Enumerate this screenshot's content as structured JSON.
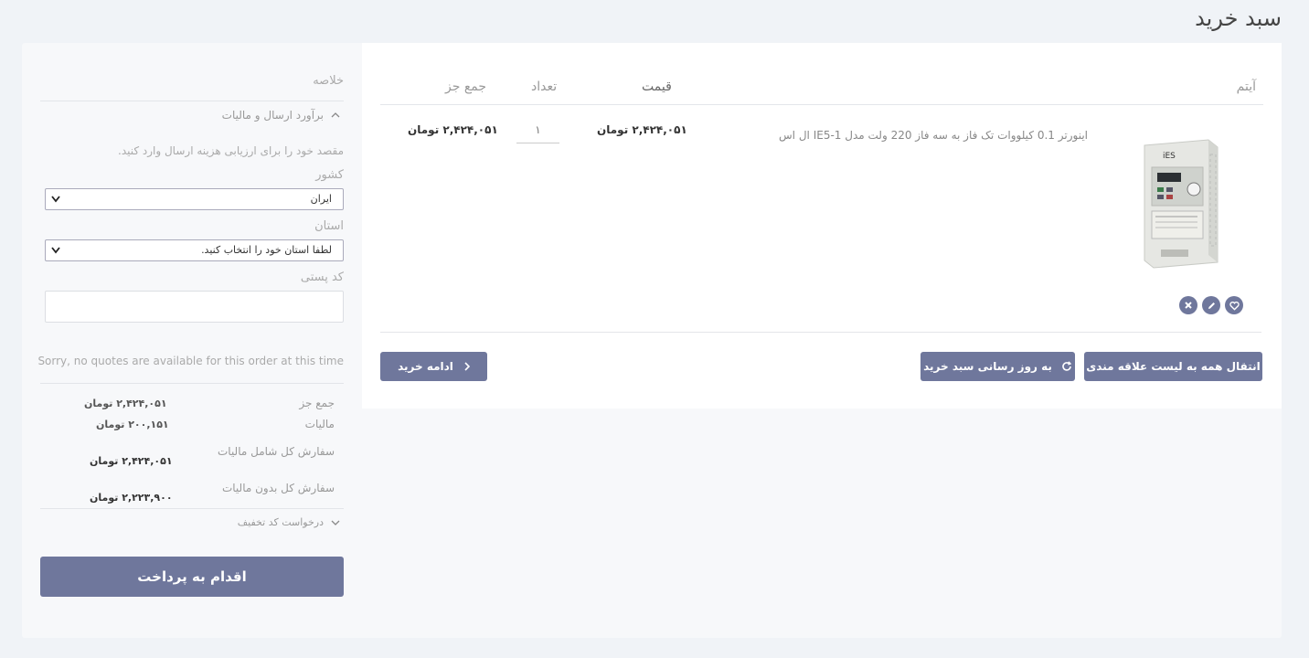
{
  "page_title": "سبد خرید",
  "cart": {
    "columns": {
      "item": "آیتم",
      "price": "قیمت",
      "qty": "تعداد",
      "subtotal": "جمع جز"
    },
    "row": {
      "name": "اینورتر 0.1 کیلووات تک فاز به سه فاز 220 ولت مدل IE5-1 ال اس",
      "price": "۲,۴۲۴,۰۵۱ تومان",
      "qty": "۱",
      "subtotal": "۲,۴۲۴,۰۵۱ تومان",
      "image_label": "iES"
    },
    "icons": [
      "heart-icon",
      "edit-icon",
      "remove-icon"
    ],
    "buttons": {
      "move_to_wishlist": "انتقال همه به لیست علاقه مندی",
      "update_cart": "به روز رسانی سبد خرید",
      "continue_shopping": "ادامه خرید"
    }
  },
  "summary": {
    "title": "خلاصه",
    "shipping_toggle": "برآورد ارسال و مالیات",
    "shipping_desc": "مقصد خود را برای ارزیابی هزینه ارسال وارد کنید.",
    "country_label": "کشور",
    "country_value": "ایران",
    "province_label": "استان",
    "province_value": "لطفا استان خود را انتخاب کنید.",
    "zip_label": "کد پستی",
    "zip_value": "",
    "no_quotes": "Sorry, no quotes are available for this order at this time",
    "rows": [
      {
        "label": "جمع جز",
        "value": "۲,۴۲۴,۰۵۱ تومان"
      },
      {
        "label": "مالیات",
        "value": "۲۰۰,۱۵۱ تومان"
      },
      {
        "label": "سفارش کل شامل مالیات",
        "value": "۲,۴۲۴,۰۵۱ تومان"
      },
      {
        "label": "سفارش کل بدون مالیات",
        "value": "۲,۲۲۳,۹۰۰ تومان"
      }
    ],
    "discount_toggle": "درخواست کد تخفیف",
    "checkout": "اقدام به پرداخت"
  },
  "colors": {
    "accent": "#6f779c",
    "background": "#f0f3f7"
  }
}
